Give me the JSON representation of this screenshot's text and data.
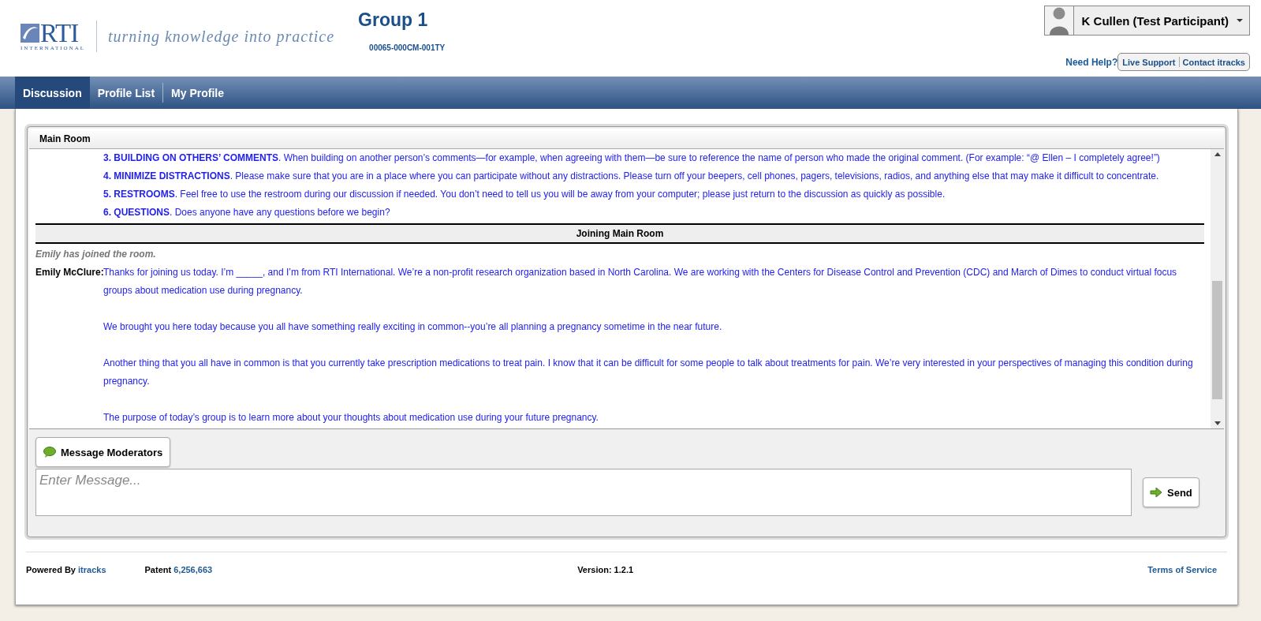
{
  "header": {
    "logo_mark": "RTI",
    "logo_sub": "INTERNATIONAL",
    "tagline": "turning knowledge into practice",
    "group_title": "Group 1",
    "group_code": "00065-000CM-001TY",
    "user": "K Cullen (Test Participant)",
    "help_label": "Need Help?",
    "help_links": [
      "Live Support",
      "Contact itracks"
    ]
  },
  "nav": [
    {
      "label": "Discussion",
      "selected": true
    },
    {
      "label": "Profile List",
      "selected": false
    },
    {
      "label": "My Profile",
      "selected": false
    }
  ],
  "room": {
    "title": "Main Room",
    "transcript": [
      {
        "kind": "rule",
        "text": "**3. BUILDING ON OTHERS’ COMMENTS**. When building on another person’s comments—for example, when agreeing with them—be sure to reference the name of person who made the original comment. (For example: “@ Ellen – I completely agree!”)"
      },
      {
        "kind": "rule",
        "text": "**4. MINIMIZE DISTRACTIONS**. Please make sure that you are in a place where you can participate without any distractions. Please turn off your beepers, cell phones, pagers, televisions, radios, and anything else that may make it difficult to concentrate."
      },
      {
        "kind": "rule",
        "text": "**5. RESTROOMS**. Feel free to use the restroom during our discussion if needed. You don’t need to tell us you will be away from your computer; please just return to the discussion as quickly as possible."
      },
      {
        "kind": "rule",
        "text": "**6. QUESTIONS**. Does anyone have any questions before we begin?"
      },
      {
        "kind": "divider",
        "text": "Joining Main Room"
      },
      {
        "kind": "system",
        "text": "Emily has joined the room."
      },
      {
        "kind": "message",
        "speaker": "Emily McClure:",
        "paragraphs": [
          "Thanks for joining us today. I’m _____, and I’m from RTI International. We’re a non-profit research organization based in North Carolina. We are working with the Centers for Disease Control and Prevention (CDC) and March of Dimes to conduct virtual focus groups about medication use during pregnancy.",
          "We brought you here today because you all have something really exciting in common--you’re all planning a pregnancy sometime in the near future.",
          "Another thing that you all have in common is that you currently take prescription medications to treat pain. I know that it can be difficult for some people to talk about treatments for pain. We’re very interested in your perspectives of managing this condition during pregnancy.",
          "The purpose of today’s group is to learn more about your thoughts about medication use during your future pregnancy."
        ]
      }
    ],
    "moderator_button": "Message Moderators",
    "message_placeholder": "Enter Message...",
    "send_button": "Send"
  },
  "footer": {
    "powered_label": "Powered By",
    "powered_link": "itracks",
    "patent_label": "Patent",
    "patent_number": "6,256,663",
    "version": "Version: 1.2.1",
    "terms": "Terms of Service"
  }
}
